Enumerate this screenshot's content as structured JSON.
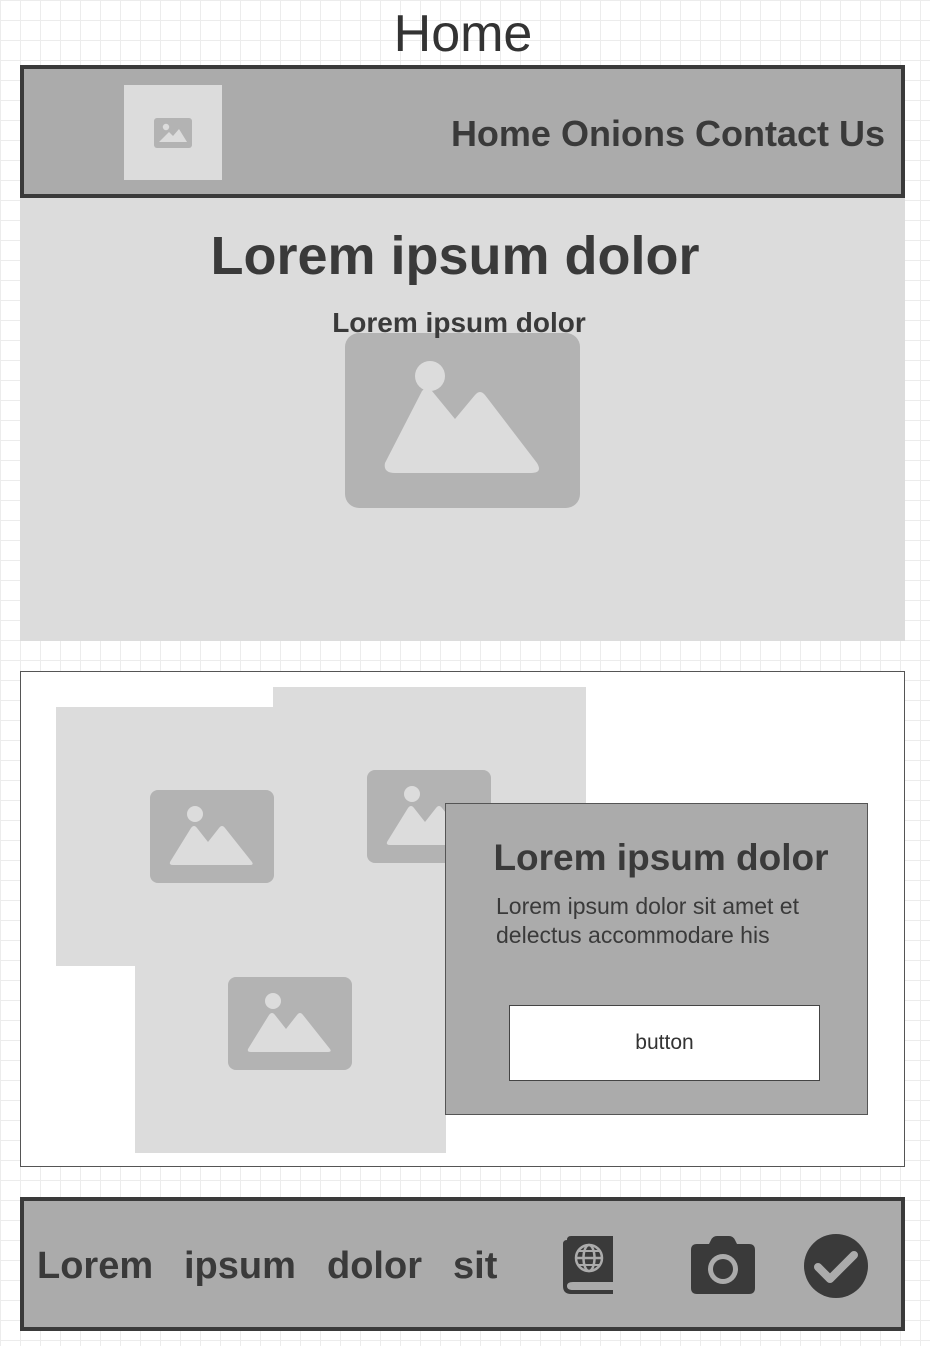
{
  "page": {
    "title": "Home"
  },
  "header": {
    "logo_icon": "image-icon",
    "nav": [
      "Home",
      "Onions",
      "Contact Us"
    ]
  },
  "hero": {
    "title": "Lorem ipsum dolor",
    "subtitle": "Lorem ipsum dolor",
    "image_icon": "image-icon"
  },
  "feature": {
    "card": {
      "title": "Lorem ipsum dolor",
      "text": "Lorem ipsum dolor sit amet et delectus accommodare his",
      "button_label": "button"
    },
    "image_icons": [
      "image-icon",
      "image-icon",
      "image-icon"
    ]
  },
  "footer": {
    "words": [
      "Lorem",
      "ipsum",
      "dolor",
      "sit"
    ],
    "icons": [
      "globe-book-icon",
      "camera-icon",
      "check-circle-icon"
    ]
  },
  "colors": {
    "bar_fill": "#ababab",
    "placeholder_fill": "#dcdcdc",
    "image_fill": "#b3b3b3",
    "dark": "#3a3a3a"
  }
}
